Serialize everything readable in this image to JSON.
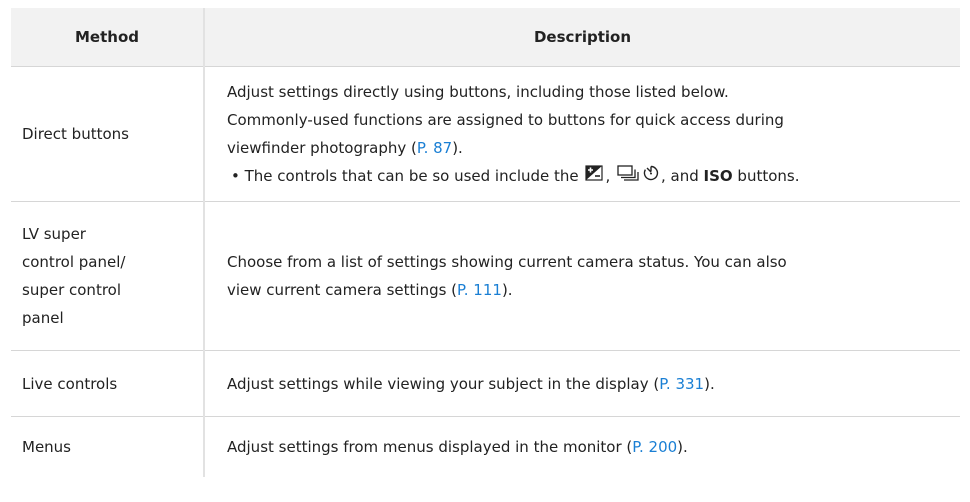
{
  "table": {
    "headers": {
      "method": "Method",
      "description": "Description"
    },
    "rows": [
      {
        "method": "Direct buttons",
        "desc_line1": "Adjust settings directly using buttons, including those listed below.",
        "desc_line2": "Commonly-used functions are assigned to buttons for quick access during",
        "desc_line3": "viewfinder photography (",
        "desc_link": "P. 87",
        "desc_end": ").",
        "bullet": "•",
        "bullet_text_a": " The controls that can be so used include the ",
        "bullet_text_b": ", ",
        "bullet_text_c": ", and ",
        "bullet_iso": "ISO",
        "bullet_text_d": " buttons.",
        "icons": [
          "exposure-compensation-icon",
          "drive-mode-icon",
          "self-timer-icon"
        ]
      },
      {
        "method_lines": [
          "LV super",
          "control panel/",
          "super control",
          "panel"
        ],
        "desc_line1": "Choose from a list of settings showing current camera status. You can also",
        "desc_line2": "view current camera settings (",
        "desc_link": "P. 111",
        "desc_end": ")."
      },
      {
        "method": "Live controls",
        "desc_text": "Adjust settings while viewing your subject in the display (",
        "desc_link": "P. 331",
        "desc_end": ")."
      },
      {
        "method": "Menus",
        "desc_text": "Adjust settings from menus displayed in the monitor (",
        "desc_link": "P. 200",
        "desc_end": ")."
      }
    ]
  }
}
